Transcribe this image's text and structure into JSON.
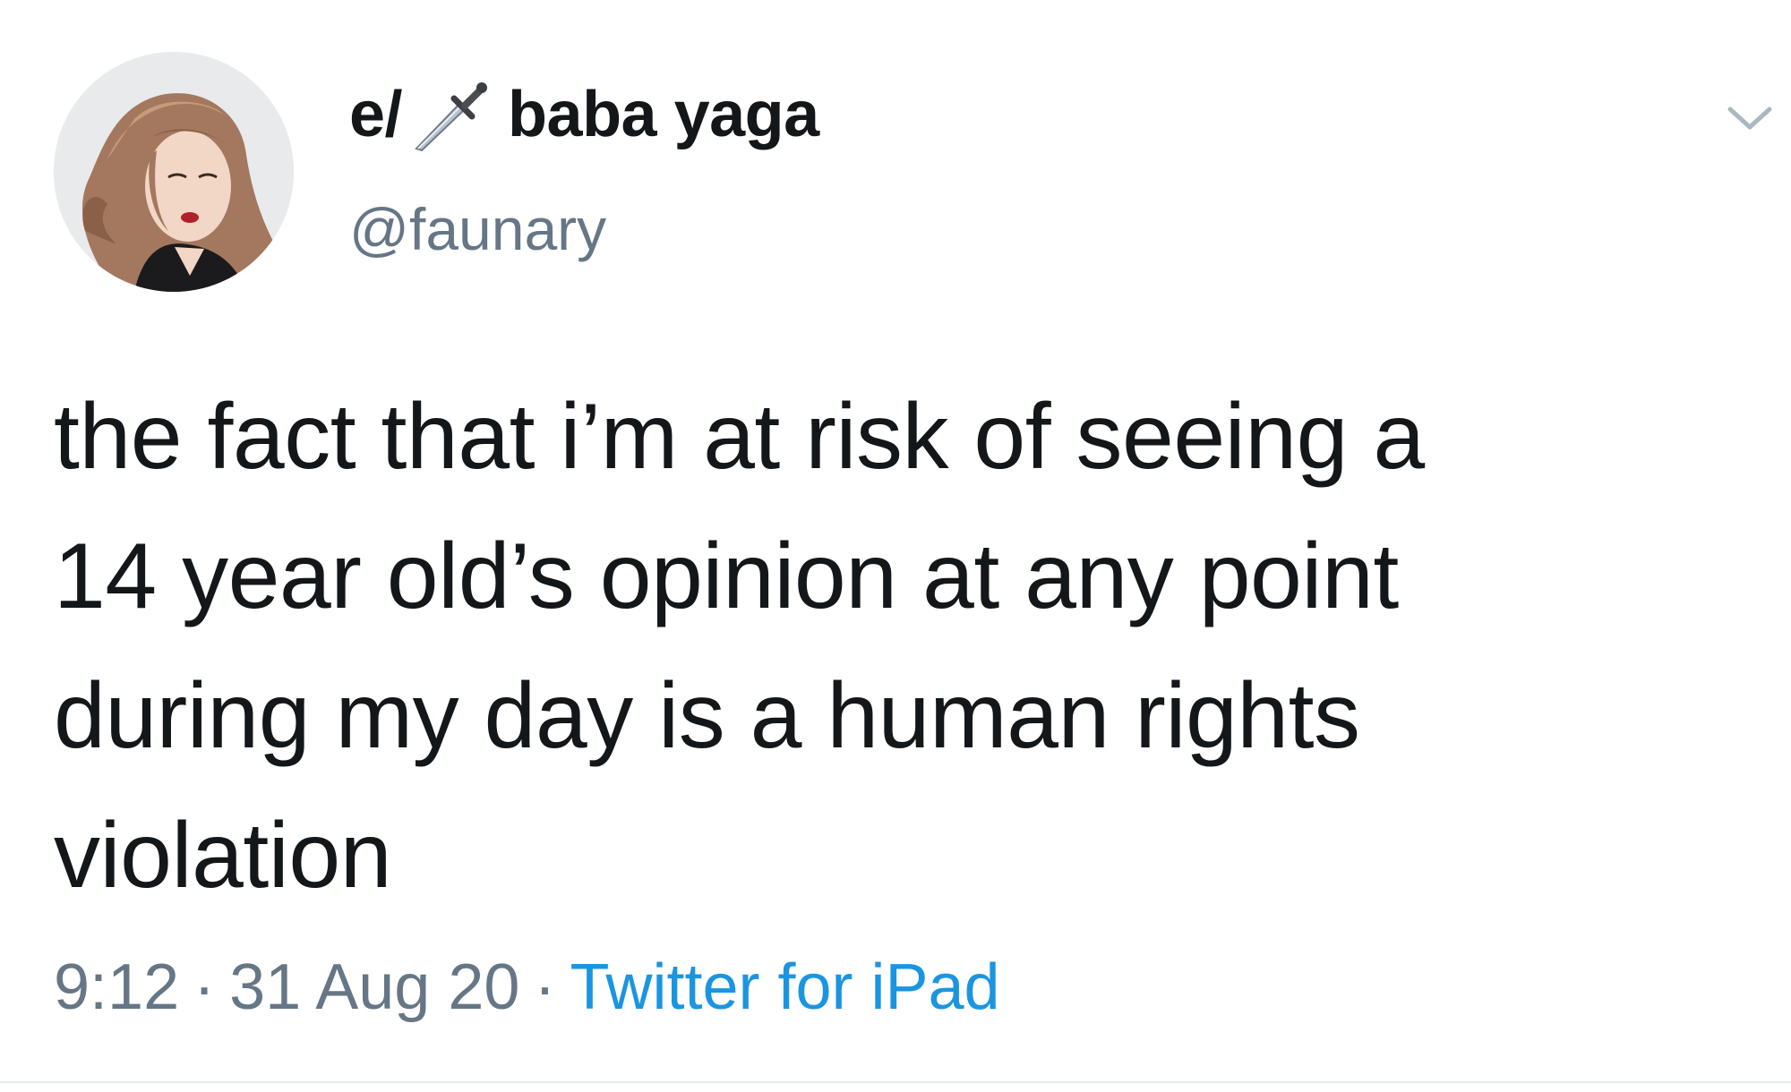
{
  "author": {
    "name_prefix": "e/",
    "name_icon": "dagger-icon",
    "name_main": "baba yaga",
    "handle": "@faunary"
  },
  "tweet": {
    "text": "the fact that i’m at risk of seeing a\n14 year old’s opinion at any point\nduring my day is a human rights\nviolation"
  },
  "meta": {
    "time": "9:12",
    "separator": "·",
    "date": "31 Aug 20",
    "source": "Twitter for iPad"
  },
  "icons": {
    "menu": "chevron-down-icon",
    "avatar": "avatar"
  },
  "colors": {
    "text": "#14171a",
    "secondary": "#657786",
    "link": "#1b95e0"
  }
}
